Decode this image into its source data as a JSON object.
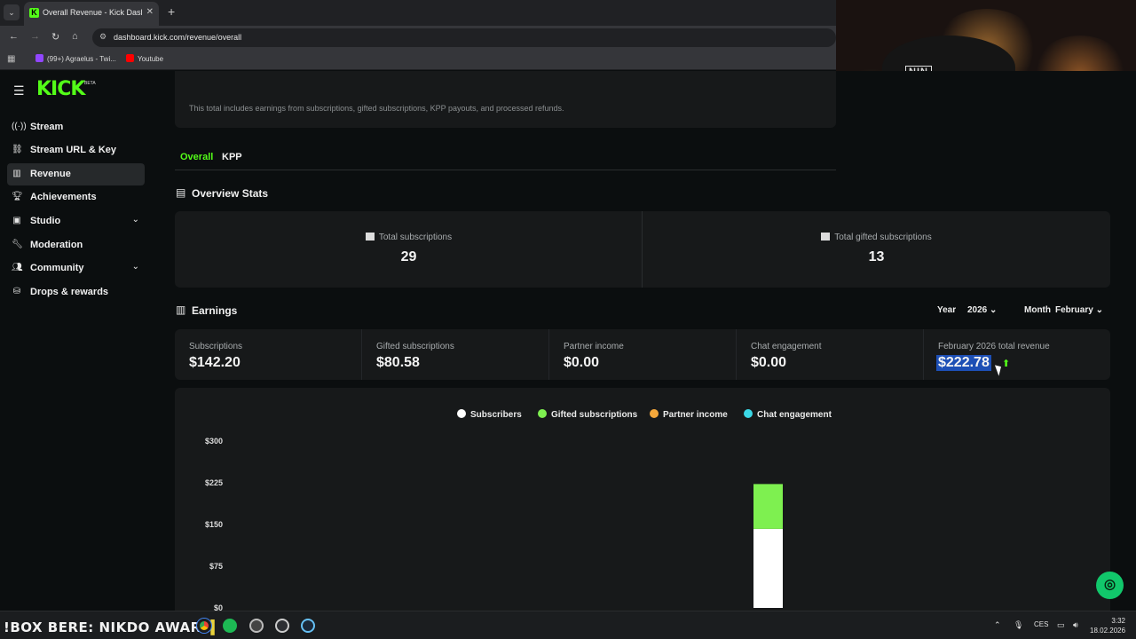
{
  "browser": {
    "tab_title": "Overall Revenue - Kick Dashboard",
    "url": "dashboard.kick.com/revenue/overall",
    "bookmarks": [
      {
        "label": "(99+) Agraelus - Twi...",
        "color": "#9146ff"
      },
      {
        "label": "Youtube",
        "color": "#ff0000"
      }
    ]
  },
  "webcam": {
    "cap_logo": "NIN"
  },
  "sidebar": {
    "logo": "KICK",
    "logo_badge": "BETA",
    "items": [
      {
        "label": "Stream",
        "icon": "broadcast-icon"
      },
      {
        "label": "Stream URL & Key",
        "icon": "link-icon"
      },
      {
        "label": "Revenue",
        "icon": "chart-icon",
        "active": true
      },
      {
        "label": "Achievements",
        "icon": "trophy-icon"
      },
      {
        "label": "Studio",
        "icon": "studio-icon",
        "expandable": true
      },
      {
        "label": "Moderation",
        "icon": "wrench-icon"
      },
      {
        "label": "Community",
        "icon": "people-icon",
        "expandable": true
      },
      {
        "label": "Drops & rewards",
        "icon": "gift-icon"
      }
    ]
  },
  "main": {
    "info_text": "This total includes earnings from subscriptions, gifted subscriptions, KPP payouts, and processed refunds.",
    "tabs": [
      {
        "label": "Overall",
        "active": true
      },
      {
        "label": "KPP",
        "active": false
      }
    ],
    "overview_title": "Overview Stats",
    "stats": [
      {
        "label": "Total subscriptions",
        "value": "29"
      },
      {
        "label": "Total gifted subscriptions",
        "value": "13"
      }
    ],
    "earnings_title": "Earnings",
    "filters": {
      "year_label": "Year",
      "year_value": "2026",
      "month_label": "Month",
      "month_value": "February"
    },
    "earnings": [
      {
        "label": "Subscriptions",
        "value": "$142.20"
      },
      {
        "label": "Gifted subscriptions",
        "value": "$80.58"
      },
      {
        "label": "Partner income",
        "value": "$0.00"
      },
      {
        "label": "Chat engagement",
        "value": "$0.00"
      },
      {
        "label": "February 2026 total revenue",
        "value": "$222.78"
      }
    ]
  },
  "chart_data": {
    "type": "bar",
    "stacked": true,
    "series": [
      {
        "name": "Subscribers",
        "color": "#ffffff",
        "values": [
          142.2
        ]
      },
      {
        "name": "Gifted subscriptions",
        "color": "#7ef050",
        "values": [
          80.58
        ]
      },
      {
        "name": "Partner income",
        "color": "#f5a83b",
        "values": [
          0
        ]
      },
      {
        "name": "Chat engagement",
        "color": "#3bd8e6",
        "values": [
          0
        ]
      }
    ],
    "yticks": [
      "$300",
      "$225",
      "$150",
      "$75",
      "$0"
    ],
    "ylim": [
      0,
      300
    ],
    "legend_position": "top-center"
  },
  "taskbar": {
    "ticker": "!BOX BERE: NIKDO AWARE",
    "language": "CES",
    "time": "3:32",
    "date": "18.02.2026"
  },
  "colors": {
    "brand": "#53fc18",
    "highlight": "#1d4fb5",
    "support": "#11c76b"
  }
}
